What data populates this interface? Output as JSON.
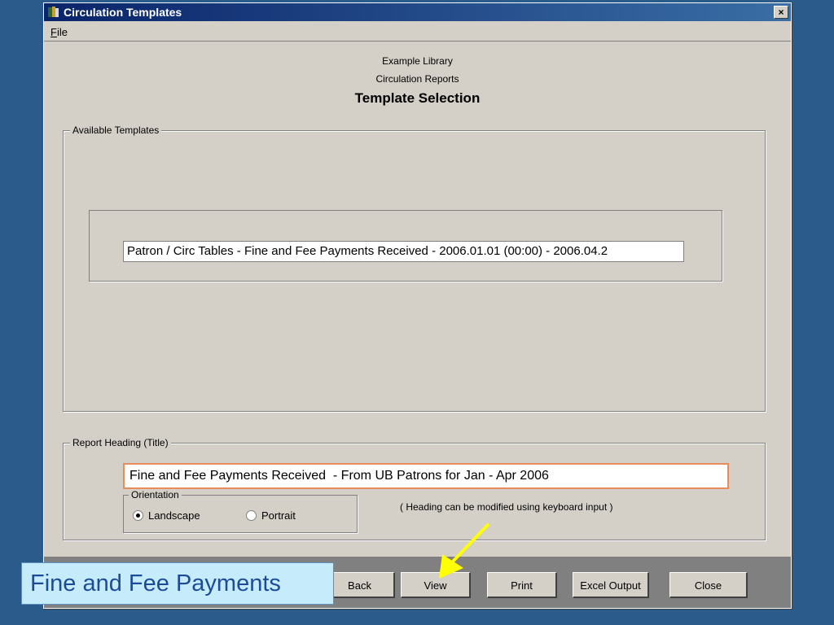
{
  "window": {
    "title": "Circulation Templates",
    "close_glyph": "×"
  },
  "menu": {
    "file": "File"
  },
  "header": {
    "line1": "Example Library",
    "line2": "Circulation Reports",
    "title": "Template Selection"
  },
  "templates": {
    "label": "Available Templates",
    "items": [
      "Patron / Circ Tables - Fine and Fee Payments Received  - 2006.01.01 (00:00) - 2006.04.2"
    ]
  },
  "heading": {
    "label": "Report Heading (Title)",
    "value": "Fine and Fee Payments Received  - From UB Patrons for Jan - Apr 2006",
    "hint": "( Heading can be modified using keyboard input )"
  },
  "orientation": {
    "label": "Orientation",
    "options": [
      "Landscape",
      "Portrait"
    ],
    "selected": "Landscape"
  },
  "buttons": {
    "back": "Back",
    "view": "View",
    "print": "Print",
    "excel": "Excel Output",
    "close": "Close"
  },
  "caption": "Fine and Fee Payments",
  "colors": {
    "caption_bg": "#c6ecfb",
    "arrow": "#ffff00",
    "titlebar": "#0a246a"
  }
}
